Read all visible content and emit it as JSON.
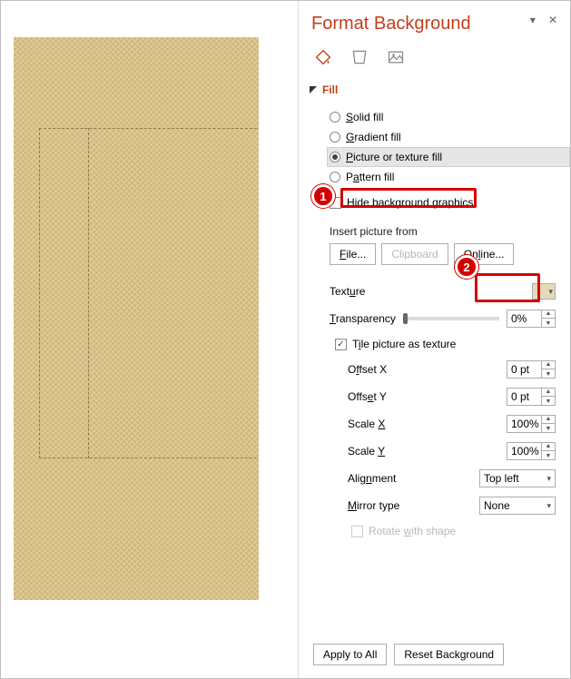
{
  "panel": {
    "title": "Format Background",
    "collapse_label": "Fill",
    "radios": {
      "solid": "Solid fill",
      "gradient": "Gradient fill",
      "picture": "Picture or texture fill",
      "pattern": "Pattern fill"
    },
    "hide_bg": "Hide background graphics",
    "insert_label": "Insert picture from",
    "buttons": {
      "file": "File...",
      "clipboard": "Clipboard",
      "online": "Online..."
    },
    "texture_label": "Texture",
    "transparency_label": "Transparency",
    "transparency_value": "0%",
    "tile_label": "Tile picture as texture",
    "offset_x_label": "Offset X",
    "offset_x_value": "0 pt",
    "offset_y_label": "Offset Y",
    "offset_y_value": "0 pt",
    "scale_x_label": "Scale X",
    "scale_x_value": "100%",
    "scale_y_label": "Scale Y",
    "scale_y_value": "100%",
    "alignment_label": "Alignment",
    "alignment_value": "Top left",
    "mirror_label": "Mirror type",
    "mirror_value": "None",
    "rotate_label": "Rotate with shape",
    "apply_all": "Apply to All",
    "reset": "Reset Background"
  },
  "callouts": {
    "one": "1",
    "two": "2"
  }
}
